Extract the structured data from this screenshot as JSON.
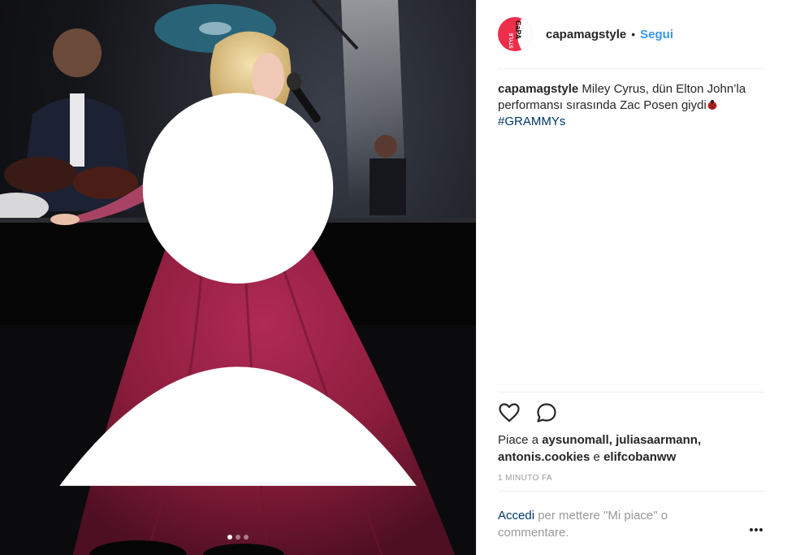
{
  "post": {
    "username": "capamagstyle",
    "separator": "•",
    "follow_label": "Segui",
    "avatar": {
      "logo_text": "CaPA",
      "logo_sub": "STYLE",
      "brand_color": "#ee2f4b"
    },
    "caption": {
      "username": "capamagstyle",
      "text": "Miley Cyrus, dün Elton John’la performansı sırasında Zac Posen giydi",
      "emoji": "ladybug-icon",
      "hashtag": "#GRAMMYs"
    },
    "likes": {
      "prefix": "Piace a",
      "user1": "aysunomall",
      "sep1": ",",
      "user2": "juliasaarmann",
      "sep2": ",",
      "user3": "antonis.cookies",
      "conj": "e",
      "user4": "elifcobanww"
    },
    "timestamp": "1 MINUTO FA",
    "comment": {
      "login_label": "Accedi",
      "prompt": "per mettere \"Mi piace\" o commentare."
    },
    "carousel": {
      "slide_count": 3,
      "active_index": 0
    }
  },
  "icons": {
    "like": "heart-icon",
    "comment": "comment-bubble-icon",
    "more": "more-options-icon",
    "tag": "user-tag-icon"
  },
  "colors": {
    "link_blue": "#3897f0",
    "hashtag_blue": "#003569",
    "muted": "#999999",
    "text": "#262626",
    "gown": "#8c1d3c"
  }
}
